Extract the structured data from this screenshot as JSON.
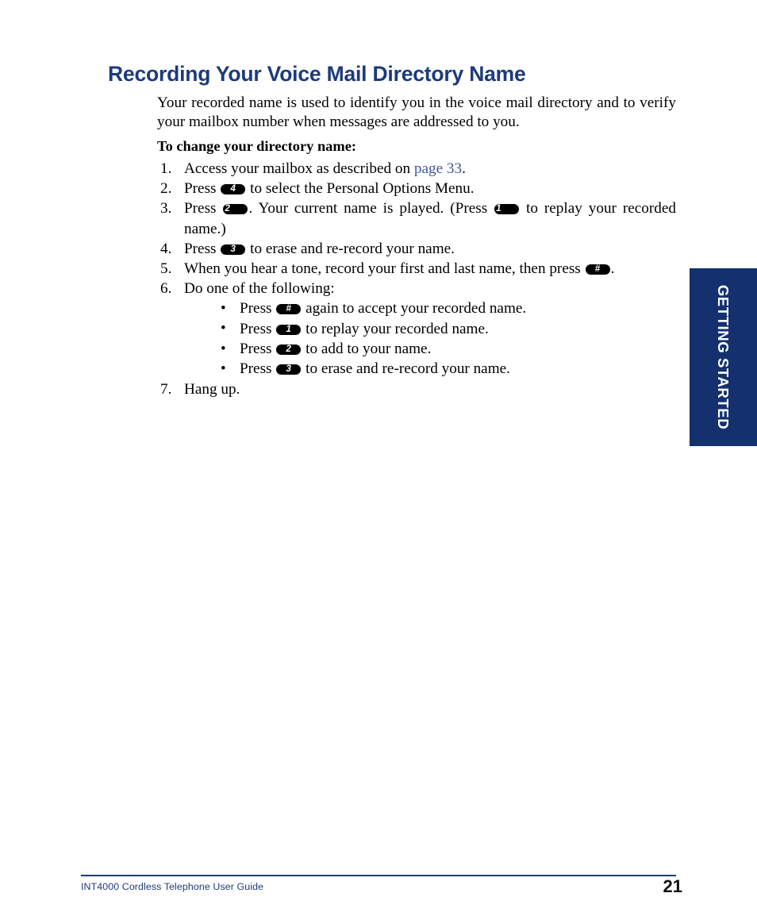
{
  "document": {
    "title": "Recording Your Voice Mail Directory Name",
    "intro": "Your recorded name is used to identify you in the voice mail directory and to verify your mailbox number when messages are addressed to you.",
    "subheading": "To change your directory name:"
  },
  "colors": {
    "heading_navy": "#1d3a7d",
    "tab_navy": "#14306e",
    "link_blue": "#43579b",
    "key_badge_bg": "#000000",
    "key_badge_text": "#ffffff",
    "page_background": "#ffffff"
  },
  "steps": [
    {
      "number": "1.",
      "parts": [
        {
          "type": "text",
          "value": "Access your mailbox as described on "
        },
        {
          "type": "link",
          "value": "page 33"
        },
        {
          "type": "text",
          "value": "."
        }
      ]
    },
    {
      "number": "2.",
      "parts": [
        {
          "type": "text",
          "value": "Press "
        },
        {
          "type": "key",
          "value": "4"
        },
        {
          "type": "text",
          "value": " to select the Personal Options Menu."
        }
      ]
    },
    {
      "number": "3.",
      "justified": true,
      "parts": [
        {
          "type": "text",
          "value": "Press "
        },
        {
          "type": "key",
          "value": "2"
        },
        {
          "type": "text",
          "value": ". Your current name is played. (Press "
        },
        {
          "type": "key",
          "value": "1"
        },
        {
          "type": "text",
          "value": " to replay your recorded name.)"
        }
      ]
    },
    {
      "number": "4.",
      "parts": [
        {
          "type": "text",
          "value": "Press "
        },
        {
          "type": "key",
          "value": "3"
        },
        {
          "type": "text",
          "value": " to erase and re-record your name."
        }
      ]
    },
    {
      "number": "5.",
      "parts": [
        {
          "type": "text",
          "value": "When you hear a tone, record your first and last name, then press "
        },
        {
          "type": "key",
          "value": "#"
        },
        {
          "type": "text",
          "value": "."
        }
      ]
    },
    {
      "number": "6.",
      "parts": [
        {
          "type": "text",
          "value": "Do one of the following:"
        }
      ],
      "sub_options": [
        {
          "bullet": "•",
          "parts": [
            {
              "type": "text",
              "value": "Press "
            },
            {
              "type": "key",
              "value": "#"
            },
            {
              "type": "text",
              "value": " again to accept your recorded name."
            }
          ]
        },
        {
          "bullet": "•",
          "parts": [
            {
              "type": "text",
              "value": "Press "
            },
            {
              "type": "key",
              "value": "1"
            },
            {
              "type": "text",
              "value": " to replay your recorded name."
            }
          ]
        },
        {
          "bullet": "•",
          "parts": [
            {
              "type": "text",
              "value": "Press "
            },
            {
              "type": "key",
              "value": "2"
            },
            {
              "type": "text",
              "value": " to add to your name."
            }
          ]
        },
        {
          "bullet": "•",
          "parts": [
            {
              "type": "text",
              "value": "Press "
            },
            {
              "type": "key",
              "value": "3"
            },
            {
              "type": "text",
              "value": " to erase and re-record your name."
            }
          ]
        }
      ]
    },
    {
      "number": "7.",
      "parts": [
        {
          "type": "text",
          "value": "Hang up."
        }
      ]
    }
  ],
  "side_tab": {
    "label": "GETTING STARTED"
  },
  "footer": {
    "guide_name": "INT4000 Cordless Telephone User Guide",
    "page_number": "21"
  }
}
